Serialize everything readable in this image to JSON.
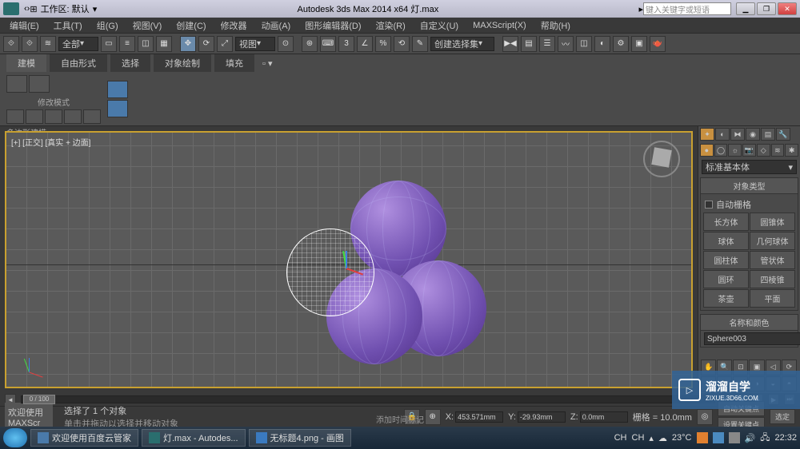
{
  "titlebar": {
    "workspace_label": "工作区: 默认",
    "app_title": "Autodesk 3ds Max  2014 x64   灯.max",
    "search_placeholder": "键入关键字或短语",
    "arrow": "▸"
  },
  "menus": [
    "编辑(E)",
    "工具(T)",
    "组(G)",
    "视图(V)",
    "创建(C)",
    "修改器",
    "动画(A)",
    "图形编辑器(D)",
    "渲染(R)",
    "自定义(U)",
    "MAXScript(X)",
    "帮助(H)"
  ],
  "toolbar": {
    "scope": "全部",
    "view_drop": "视图",
    "set_drop": "创建选择集"
  },
  "ribbon": {
    "tabs": [
      "建模",
      "自由形式",
      "选择",
      "对象绘制",
      "填充"
    ],
    "mode_label": "修改模式",
    "footer": "多边形建模 ▾"
  },
  "viewport": {
    "label": "[+] [正交] [真实 + 边面]"
  },
  "panel": {
    "category": "标准基本体",
    "section_objtype": "对象类型",
    "auto_grid": "自动栅格",
    "primitives": [
      [
        "长方体",
        "圆锥体"
      ],
      [
        "球体",
        "几何球体"
      ],
      [
        "圆柱体",
        "管状体"
      ],
      [
        "圆环",
        "四棱锥"
      ],
      [
        "茶壶",
        "平面"
      ]
    ],
    "section_name": "名称和颜色",
    "object_name": "Sphere003"
  },
  "timeline": {
    "frame": "0 / 100"
  },
  "status": {
    "welcome": "欢迎使用",
    "maxscr": "MAXScr",
    "selection": "选择了 1 个对象",
    "hint": "单击并拖动以选择并移动对象",
    "x_label": "X:",
    "x": "453.571mm",
    "y_label": "Y:",
    "y": "-29.93mm",
    "z_label": "Z:",
    "z": "0.0mm",
    "grid_label": "栅格 = 10.0mm",
    "autokey": "自动关键点",
    "setkey": "设置关键点",
    "addtag": "添加时间标记",
    "selfilter": "选定"
  },
  "watermark": {
    "brand": "溜溜自学",
    "url": "ZIXUE.3D66.COM"
  },
  "taskbar": {
    "items": [
      "欢迎使用百度云管家",
      "灯.max - Autodes...",
      "无标题4.png - 画图"
    ],
    "lang": "CH",
    "ime": "CH",
    "temp": "23°C",
    "time": "22:32"
  }
}
